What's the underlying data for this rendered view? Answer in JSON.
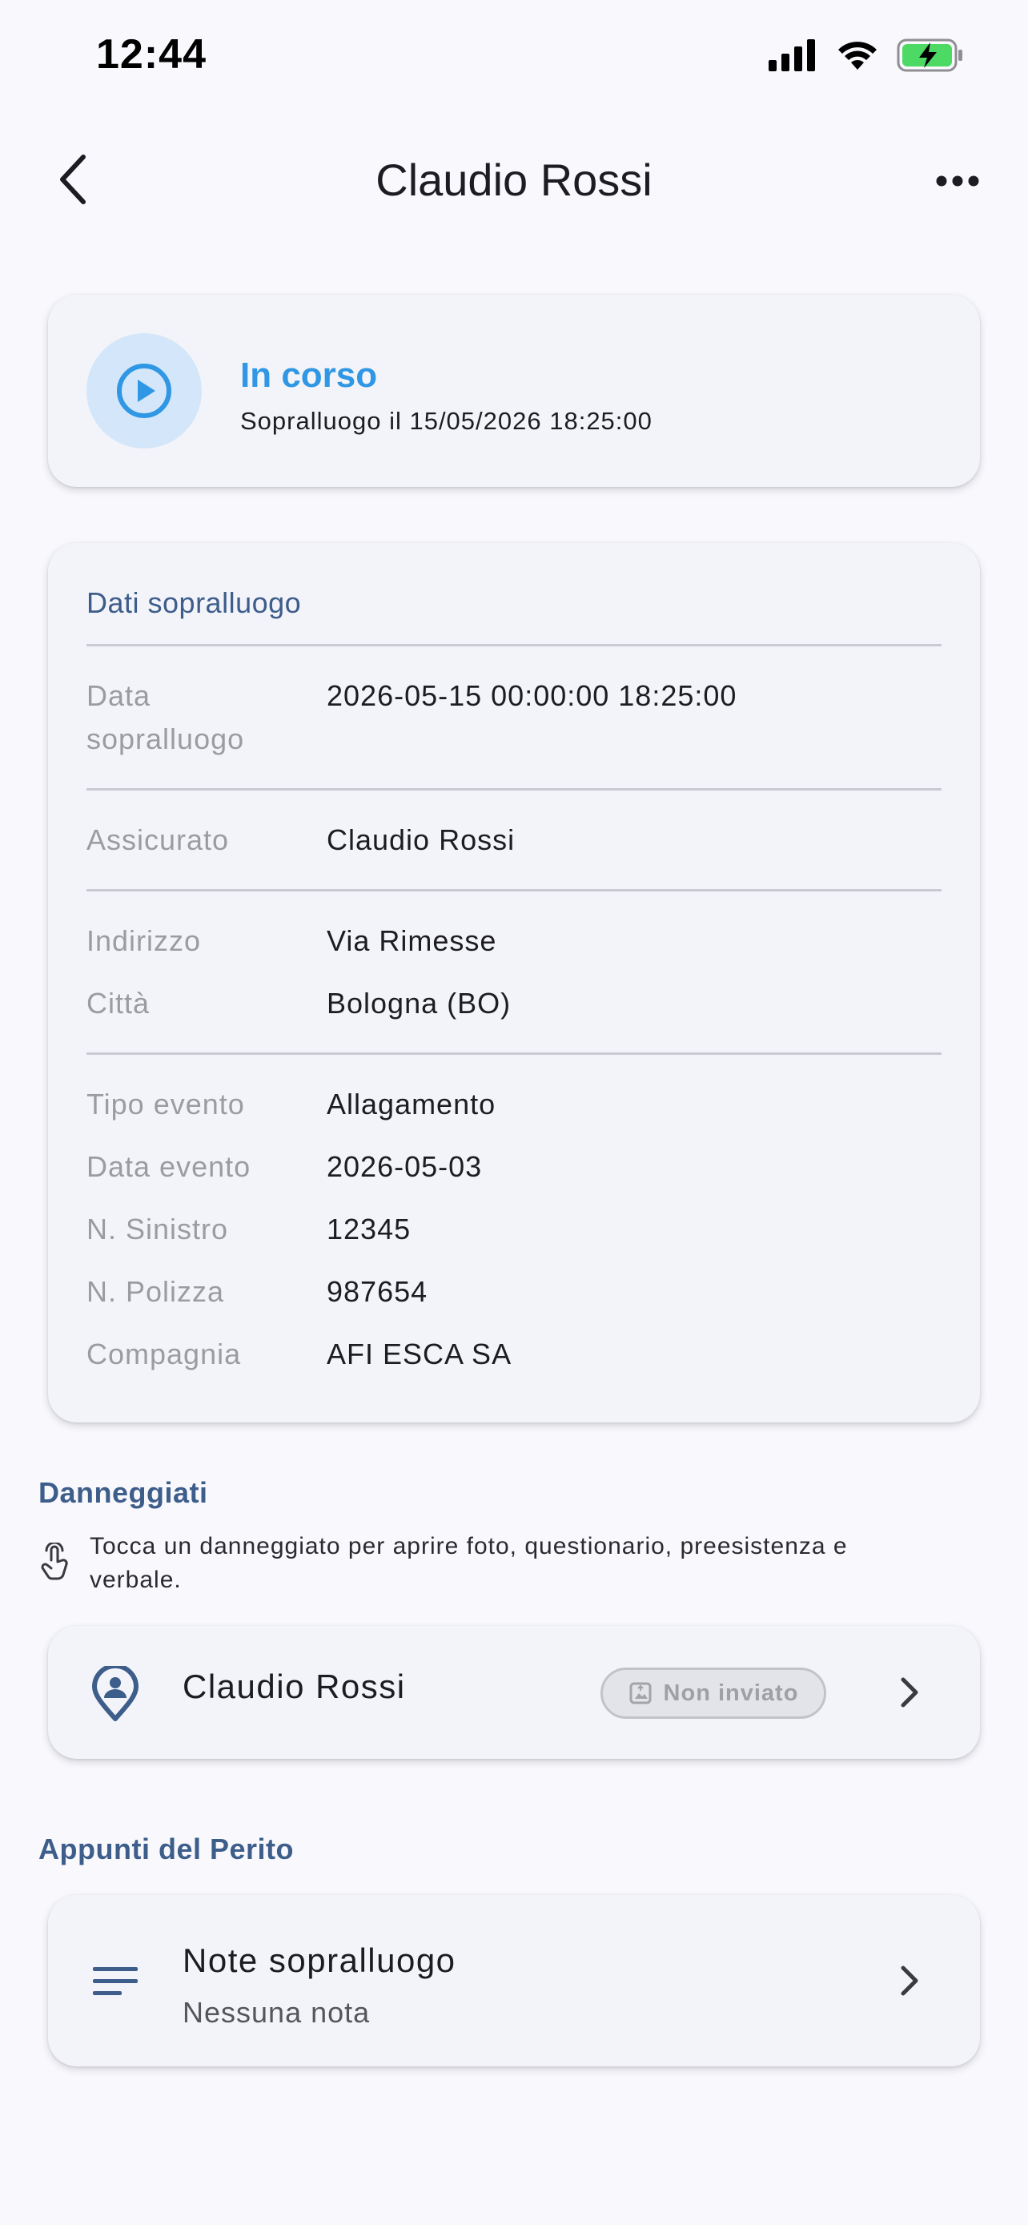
{
  "status_bar": {
    "time": "12:44"
  },
  "header": {
    "title": "Claudio Rossi"
  },
  "status_card": {
    "title": "In corso",
    "subtitle": "Sopralluogo il 15/05/2026 18:25:00"
  },
  "details": {
    "section_title": "Dati sopralluogo",
    "data_sopralluogo": {
      "label_line1": "Data",
      "label_line2": "sopralluogo",
      "value": "2026-05-15 00:00:00 18:25:00"
    },
    "assicurato": {
      "label": "Assicurato",
      "value": "Claudio Rossi"
    },
    "indirizzo": {
      "label": "Indirizzo",
      "value": "Via Rimesse"
    },
    "citta": {
      "label": "Città",
      "value": "Bologna (BO)"
    },
    "tipo_evento": {
      "label": "Tipo evento",
      "value": "Allagamento"
    },
    "data_evento": {
      "label": "Data evento",
      "value": "2026-05-03"
    },
    "n_sinistro": {
      "label": "N. Sinistro",
      "value": "12345"
    },
    "n_polizza": {
      "label": "N. Polizza",
      "value": "987654"
    },
    "compagnia": {
      "label": "Compagnia",
      "value": "AFI ESCA SA"
    }
  },
  "danneggiati": {
    "heading": "Danneggiati",
    "hint_line1": "Tocca un danneggiato per aprire foto, questionario, preesistenza e",
    "hint_line2": "verbale.",
    "items": [
      {
        "name": "Claudio Rossi",
        "badge": "Non inviato"
      }
    ]
  },
  "appunti": {
    "heading": "Appunti del Perito",
    "notes_title": "Note sopralluogo",
    "notes_subtitle": "Nessuna nota"
  },
  "colors": {
    "accent_blue": "#2f97e3",
    "section_blue": "#3d5d8a",
    "battery_green": "#4cd964"
  },
  "icons": {
    "back": "chevron-left-icon",
    "more": "ellipsis-icon",
    "status": "play-circle-icon",
    "hint": "tap-hand-icon",
    "person": "person-pin-icon",
    "badge": "upload-photo-icon",
    "notes": "notes-lines-icon",
    "chevron": "chevron-right-icon"
  }
}
